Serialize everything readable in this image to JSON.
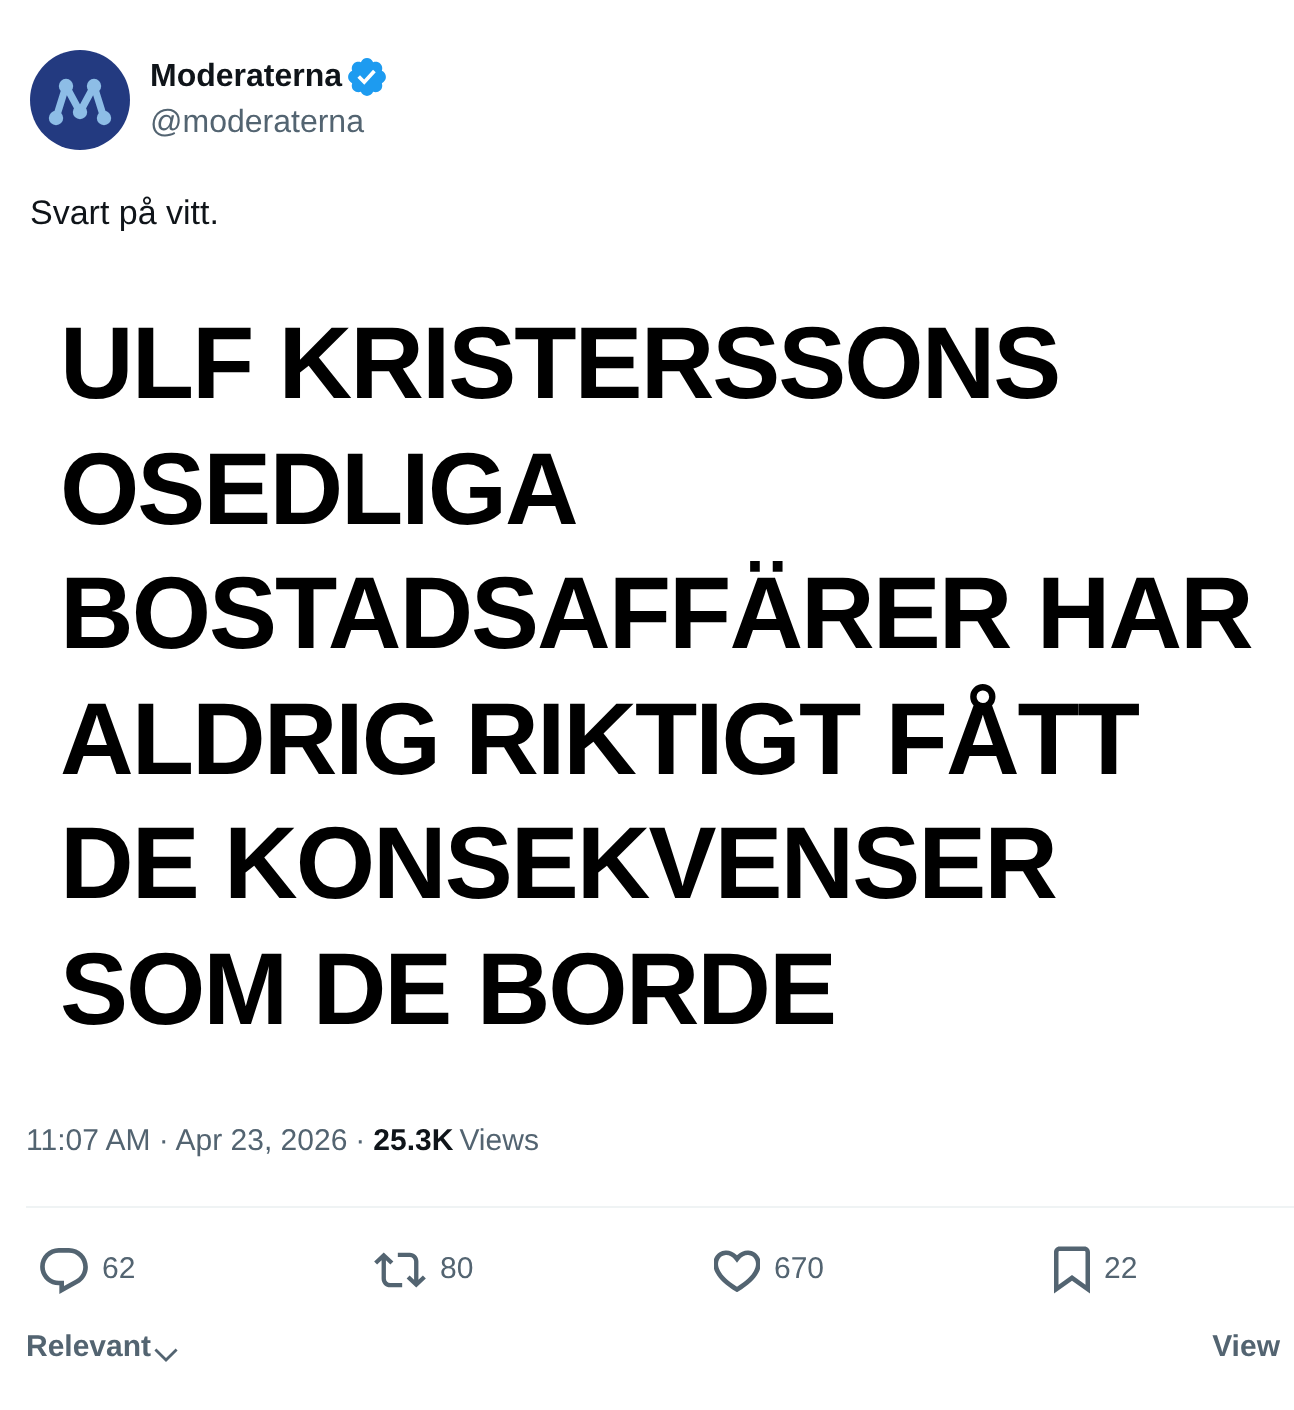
{
  "author": {
    "name": "Moderaterna",
    "verified": true,
    "handle": "@moderaterna"
  },
  "text": "Svart på vitt.",
  "image": {
    "lines": [
      "ULF KRISTERSSONS",
      "OSEDLIGA",
      "BOSTADSAFFÄRER HAR",
      "ALDRIG RIKTIGT FÅTT",
      "DE KONSEKVENSER",
      "SOM DE BORDE"
    ]
  },
  "meta": {
    "timestamp": "11:07 AM · Apr 23, 2026",
    "separator": "·",
    "views_count": "25.3K",
    "views_label": "Views"
  },
  "actions": [
    {
      "kind": "reply",
      "count": "62"
    },
    {
      "kind": "repost",
      "count": "80"
    },
    {
      "kind": "like",
      "count": "670"
    },
    {
      "kind": "bookmark",
      "count": "22"
    }
  ],
  "replies": {
    "sort_label": "Relevant",
    "view_link": "View"
  }
}
